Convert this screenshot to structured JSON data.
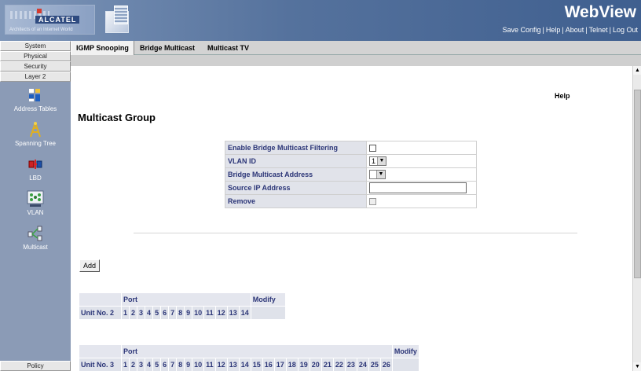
{
  "header": {
    "logo_word": "ALCATEL",
    "logo_tagline": "Architects of an Internet World",
    "title": "WebView",
    "links": [
      "Save Config",
      "Help",
      "About",
      "Telnet",
      "Log Out"
    ],
    "separator": "|"
  },
  "sidebar": {
    "menu": [
      "System",
      "Physical",
      "Security",
      "Layer 2"
    ],
    "items": [
      {
        "label": "Address Tables",
        "icon": "address-tables-icon"
      },
      {
        "label": "Spanning Tree",
        "icon": "spanning-tree-icon"
      },
      {
        "label": "LBD",
        "icon": "lbd-icon"
      },
      {
        "label": "VLAN",
        "icon": "vlan-icon"
      },
      {
        "label": "Multicast",
        "icon": "multicast-icon"
      }
    ],
    "bottom": "Policy"
  },
  "tabs": [
    "IGMP Snooping",
    "Bridge Multicast",
    "Multicast TV"
  ],
  "content": {
    "help": "Help",
    "page_title": "Multicast Group",
    "form": {
      "enable_label": "Enable Bridge Multicast Filtering",
      "vlan_label": "VLAN ID",
      "vlan_value": "1",
      "bma_label": "Bridge Multicast Address",
      "bma_value": "",
      "src_label": "Source IP Address",
      "src_value": "",
      "remove_label": "Remove"
    },
    "add_button": "Add",
    "unit2": {
      "port_label": "Port",
      "modify_label": "Modify",
      "unit_label": "Unit No. 2",
      "ports": [
        "1",
        "2",
        "3",
        "4",
        "5",
        "6",
        "7",
        "8",
        "9",
        "10",
        "11",
        "12",
        "13",
        "14"
      ]
    },
    "unit3": {
      "port_label": "Port",
      "modify_label": "Modify",
      "unit_label": "Unit No. 3",
      "ports": [
        "1",
        "2",
        "3",
        "4",
        "5",
        "6",
        "7",
        "8",
        "9",
        "10",
        "11",
        "12",
        "13",
        "14",
        "15",
        "16",
        "17",
        "18",
        "19",
        "20",
        "21",
        "22",
        "23",
        "24",
        "25",
        "26"
      ]
    }
  },
  "colors": {
    "header_bg": "#4a6896",
    "sidebar_bg": "#8b9bb6",
    "label_text": "#2b3577",
    "label_bg": "#e1e3ea"
  }
}
